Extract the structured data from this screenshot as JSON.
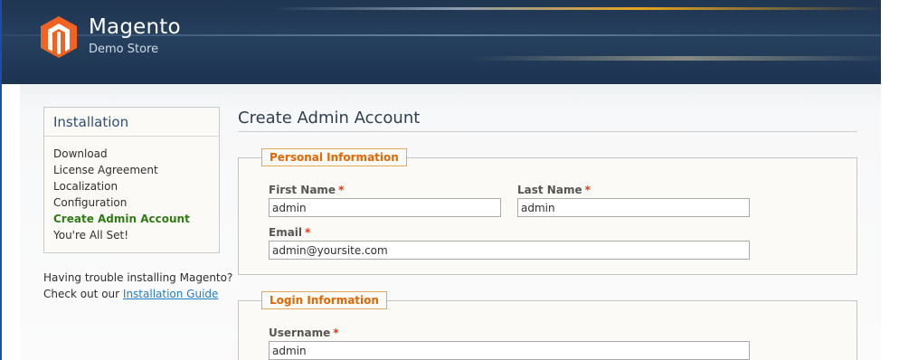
{
  "header": {
    "brand_name": "Magento",
    "brand_sub": "Demo Store",
    "logo_colors": {
      "orange": "#f26322",
      "white": "#ffffff"
    }
  },
  "sidebar": {
    "title": "Installation",
    "steps": [
      {
        "label": "Download",
        "active": false
      },
      {
        "label": "License Agreement",
        "active": false
      },
      {
        "label": "Localization",
        "active": false
      },
      {
        "label": "Configuration",
        "active": false
      },
      {
        "label": "Create Admin Account",
        "active": true
      },
      {
        "label": "You're All Set!",
        "active": false
      }
    ],
    "help_line1": "Having trouble installing Magento?",
    "help_line2": "Check out our",
    "help_link": "Installation Guide"
  },
  "main": {
    "title": "Create Admin Account",
    "personal": {
      "legend": "Personal Information",
      "first_name_label": "First Name",
      "first_name_value": "admin",
      "last_name_label": "Last Name",
      "last_name_value": "admin",
      "email_label": "Email",
      "email_value": "admin@yoursite.com"
    },
    "login": {
      "legend": "Login Information",
      "username_label": "Username",
      "username_value": "admin"
    },
    "required_marker": "*"
  },
  "colors": {
    "accent_orange": "#e26703",
    "active_step": "#2f7c16",
    "link": "#1e7ec8",
    "required": "#eb340a"
  }
}
